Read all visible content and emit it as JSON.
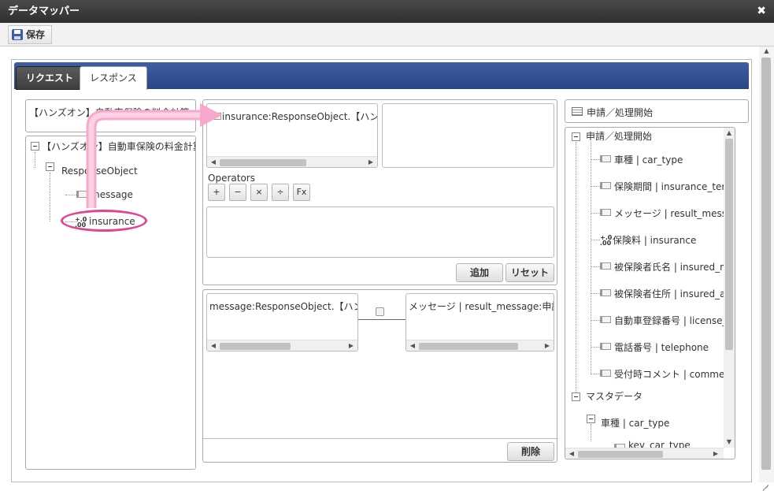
{
  "window": {
    "title": "データマッパー",
    "close_glyph": "✖"
  },
  "toolbar": {
    "save_label": "保存",
    "save_icon": "floppy-disk-icon"
  },
  "tabs": [
    {
      "label": "リクエスト",
      "active": false
    },
    {
      "label": "レスポンス",
      "active": true
    }
  ],
  "source": {
    "selector": "【ハンズオン】自動車保険の料金計算",
    "tree": {
      "root": "【ハンズオン】自動車保険の料金計算",
      "object": "ResponseObject",
      "fields": [
        {
          "label": "message",
          "icon": "field-icon"
        },
        {
          "label": "insurance",
          "icon": "number-icon"
        }
      ]
    }
  },
  "editor": {
    "expression_item": "insurance:ResponseObject.【ハンズオ",
    "operators_label": "Operators",
    "operators": [
      "+",
      "−",
      "×",
      "÷",
      "Fx"
    ],
    "add_label": "追加",
    "reset_label": "リセット"
  },
  "mapping": {
    "source_item": "message:ResponseObject.【ハンズ",
    "target_item": "メッセージ | result_message:申請／",
    "delete_label": "削除"
  },
  "target": {
    "selector": "申請／処理開始",
    "root": "申請／処理開始",
    "fields": [
      {
        "label": "車種 | car_type",
        "icon": "field-icon"
      },
      {
        "label": "保険期間 | insurance_term",
        "icon": "field-icon"
      },
      {
        "label": "メッセージ | result_message",
        "icon": "field-icon"
      },
      {
        "label": "保険料 | insurance",
        "icon": "number-icon"
      },
      {
        "label": "被保険者氏名 | insured_name",
        "icon": "field-icon"
      },
      {
        "label": "被保険者住所 | insured_address",
        "icon": "field-icon"
      },
      {
        "label": "自動車登録番号 | license_number",
        "icon": "field-icon"
      },
      {
        "label": "電話番号 | telephone",
        "icon": "field-icon"
      },
      {
        "label": "受付時コメント | comment",
        "icon": "field-icon"
      }
    ],
    "master": "マスタデータ",
    "master_child": "車種 | car_type",
    "master_grandchild": "key_car_type"
  },
  "colors": {
    "tab_bar": "#3a5599",
    "annotation": "#e3438f"
  }
}
